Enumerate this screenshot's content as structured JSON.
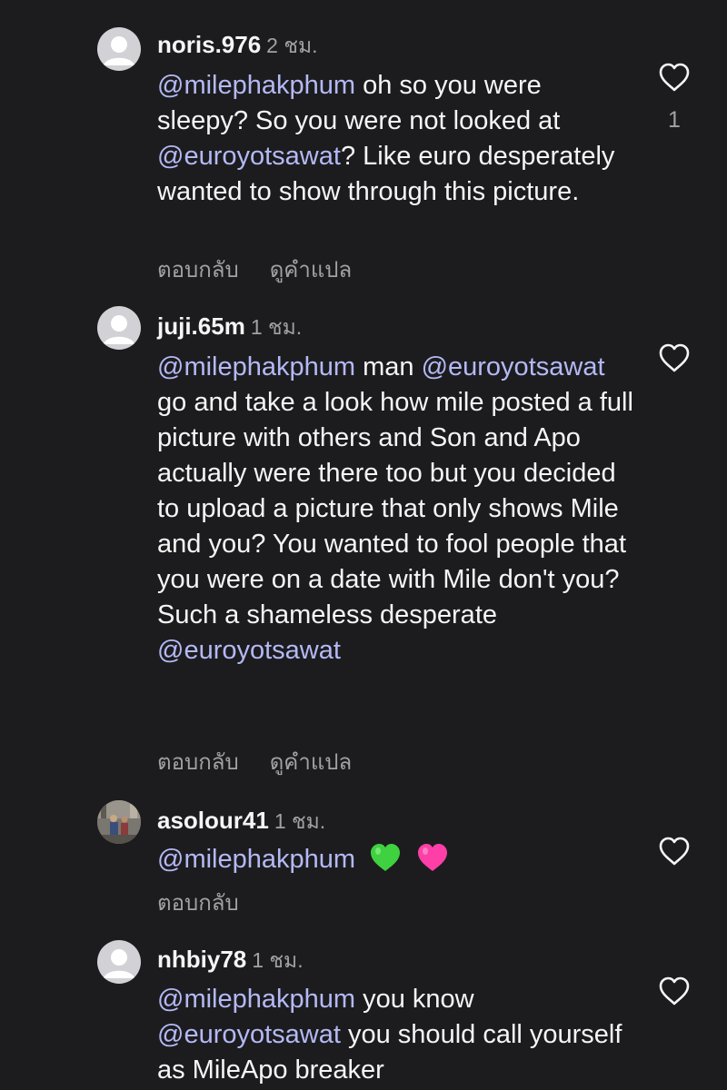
{
  "comments": [
    {
      "username": "noris.976",
      "time": "2 ชม.",
      "avatar": "default-avatar",
      "parts": [
        {
          "t": "@milephakphum",
          "m": true
        },
        {
          "t": " oh so you were sleepy? So you were not looked at ",
          "m": false
        },
        {
          "t": "@euroyotsawat",
          "m": true
        },
        {
          "t": "? Like euro desperately wanted to show through this picture.",
          "m": false
        }
      ],
      "reply_label": "ตอบกลับ",
      "translate_label": "ดูคำแปล",
      "like_count": "1"
    },
    {
      "username": "juji.65m",
      "time": "1 ชม.",
      "avatar": "default-avatar",
      "parts": [
        {
          "t": "@milephakphum",
          "m": true
        },
        {
          "t": " man ",
          "m": false
        },
        {
          "t": "@euroyotsawat",
          "m": true
        },
        {
          "t": " go and take a look how mile posted a full picture with others and Son and Apo actually were there too but you decided to upload a picture that only shows Mile and you? You wanted to fool people that you were on a date with Mile don't you? Such a shameless desperate ",
          "m": false
        },
        {
          "t": "@euroyotsawat",
          "m": true
        }
      ],
      "reply_label": "ตอบกลับ",
      "translate_label": "ดูคำแปล",
      "like_count": ""
    },
    {
      "username": "asolour41",
      "time": "1 ชม.",
      "avatar": "photo-avatar",
      "parts": [
        {
          "t": "@milephakphum",
          "m": true
        }
      ],
      "emojis": [
        "green-heart-icon",
        "pink-heart-icon"
      ],
      "reply_label": "ตอบกลับ",
      "translate_label": "",
      "like_count": ""
    },
    {
      "username": "nhbiy78",
      "time": "1 ชม.",
      "avatar": "default-avatar",
      "parts": [
        {
          "t": "@milephakphum",
          "m": true
        },
        {
          "t": " you know ",
          "m": false
        },
        {
          "t": "@euroyotsawat",
          "m": true
        },
        {
          "t": " you should call yourself as MileApo breaker",
          "m": false
        }
      ],
      "reply_label": "",
      "translate_label": "",
      "like_count": ""
    }
  ],
  "colors": {
    "background": "#1c1c1e",
    "mention": "#b4b9f5",
    "text": "#f5f5f5",
    "secondary": "#a1a1a6",
    "green_heart": "#3fd13f",
    "pink_heart": "#ff3fa8"
  }
}
